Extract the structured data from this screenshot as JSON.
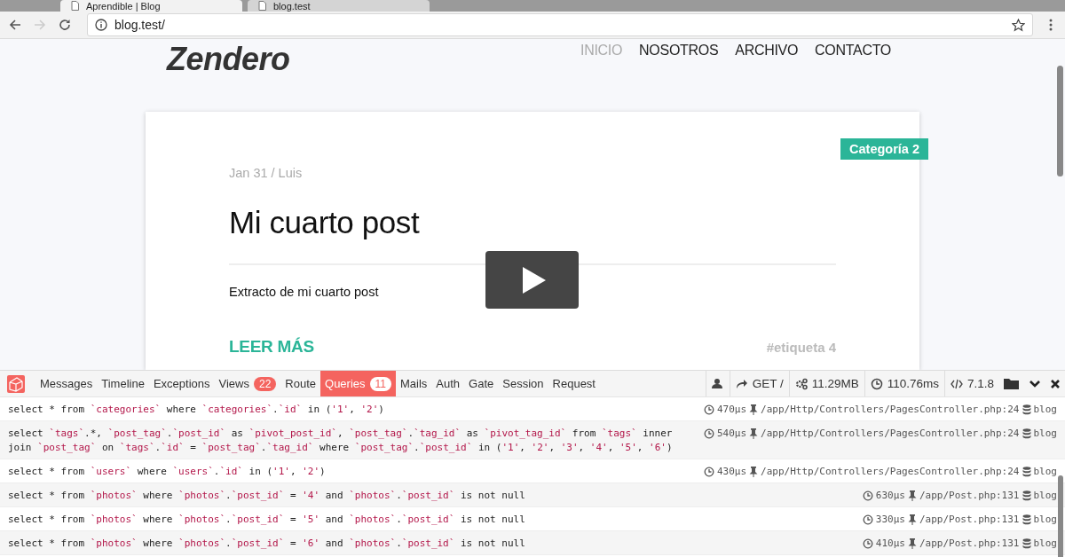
{
  "browser": {
    "tabs": [
      {
        "title": "Aprendible | Blog",
        "selected": true
      },
      {
        "title": "blog.test",
        "selected": false
      }
    ],
    "address": "blog.test/"
  },
  "site": {
    "logo": "Zendero",
    "nav": [
      {
        "label": "INICIO",
        "selected": true
      },
      {
        "label": "NOSOTROS",
        "selected": false
      },
      {
        "label": "ARCHIVO",
        "selected": false
      },
      {
        "label": "CONTACTO",
        "selected": false
      }
    ]
  },
  "post": {
    "category": "Categoría 2",
    "meta": "Jan 31 / Luis",
    "title": "Mi cuarto post",
    "excerpt": "Extracto de mi cuarto post",
    "read_more": "LEER MÁS",
    "tag": "#etiqueta 4"
  },
  "debugbar": {
    "tabs": [
      {
        "label": "Messages",
        "selected": false
      },
      {
        "label": "Timeline",
        "selected": false
      },
      {
        "label": "Exceptions",
        "selected": false
      },
      {
        "label": "Views",
        "count": "22",
        "selected": false
      },
      {
        "label": "Route",
        "selected": false
      },
      {
        "label": "Queries",
        "count": "11",
        "selected": true
      },
      {
        "label": "Mails",
        "selected": false
      },
      {
        "label": "Auth",
        "selected": false
      },
      {
        "label": "Gate",
        "selected": false
      },
      {
        "label": "Session",
        "selected": false
      },
      {
        "label": "Request",
        "selected": false
      }
    ],
    "indicators": [
      {
        "kind": "user"
      },
      {
        "kind": "route",
        "text": "GET /"
      },
      {
        "kind": "memory",
        "text": "11.29MB"
      },
      {
        "kind": "time",
        "text": "110.76ms"
      },
      {
        "kind": "version",
        "text": "7.1.8"
      }
    ],
    "queries": [
      {
        "sql": "select * from `categories` where `categories`.`id` in ('1', '2')",
        "duration": "470μs",
        "source": "/app/Http/Controllers/PagesController.php:24",
        "connection": "blog"
      },
      {
        "sql": "select `tags`.*, `post_tag`.`post_id` as `pivot_post_id`, `post_tag`.`tag_id` as `pivot_tag_id` from `tags` inner join `post_tag` on `tags`.`id` = `post_tag`.`tag_id` where `post_tag`.`post_id` in ('1', '2', '3', '4', '5', '6')",
        "duration": "540μs",
        "source": "/app/Http/Controllers/PagesController.php:24",
        "connection": "blog"
      },
      {
        "sql": "select * from `users` where `users`.`id` in ('1', '2')",
        "duration": "430μs",
        "source": "/app/Http/Controllers/PagesController.php:24",
        "connection": "blog"
      },
      {
        "sql": "select * from `photos` where `photos`.`post_id` = '4' and `photos`.`post_id` is not null",
        "duration": "630μs",
        "source": "/app/Post.php:131",
        "connection": "blog"
      },
      {
        "sql": "select * from `photos` where `photos`.`post_id` = '5' and `photos`.`post_id` is not null",
        "duration": "330μs",
        "source": "/app/Post.php:131",
        "connection": "blog"
      },
      {
        "sql": "select * from `photos` where `photos`.`post_id` = '6' and `photos`.`post_id` is not null",
        "duration": "410μs",
        "source": "/app/Post.php:131",
        "connection": "blog"
      }
    ]
  }
}
